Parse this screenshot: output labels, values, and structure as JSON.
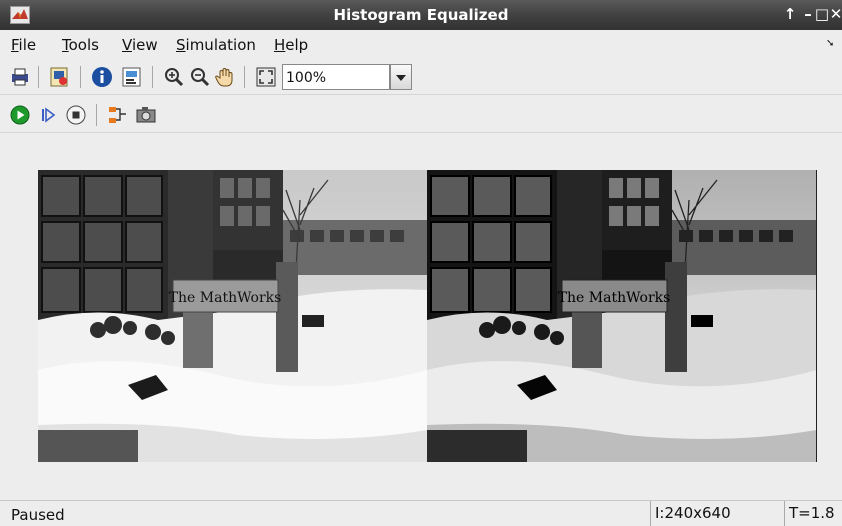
{
  "window": {
    "title": "Histogram Equalized",
    "controls": {
      "pin": "↑",
      "minimize": "–",
      "maximize": "□",
      "close": "✕"
    },
    "app_icon": "matlab-icon"
  },
  "menu": {
    "items": [
      {
        "accel": "F",
        "rest": "ile"
      },
      {
        "accel": "T",
        "rest": "ools"
      },
      {
        "accel": "V",
        "rest": "iew"
      },
      {
        "accel": "S",
        "rest": "imulation"
      },
      {
        "accel": "H",
        "rest": "elp"
      }
    ],
    "overflow_icon": "dock-arrow-icon"
  },
  "toolbar": {
    "icons": [
      "print-icon",
      "export-icon",
      "info-icon",
      "properties-icon",
      "zoom-in-icon",
      "zoom-out-icon",
      "pan-hand-icon",
      "fit-to-view-icon"
    ],
    "zoom_value": "100%"
  },
  "sim_toolbar": {
    "icons": [
      "run-icon",
      "step-forward-icon",
      "stop-icon",
      "highlight-icon",
      "snapshot-icon"
    ]
  },
  "viewer": {
    "left_sign": "The MathWorks",
    "right_sign": "The MathWorks"
  },
  "status": {
    "state": "Paused",
    "image_info": "I:240x640",
    "time": "T=1.8"
  },
  "colors": {
    "title_bar": "#3d3d3d",
    "run_green": "#1e9a2c",
    "info_blue": "#1d4fa0"
  }
}
